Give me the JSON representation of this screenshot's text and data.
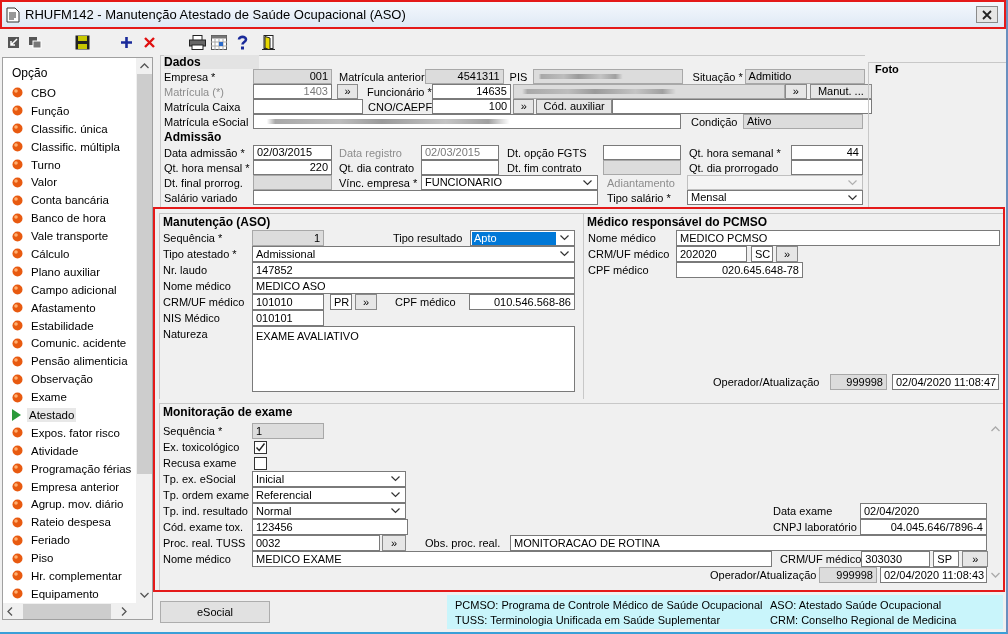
{
  "window": {
    "title": "RHUFM142 - Manutenção Atestado de Saúde Ocupacional (ASO)"
  },
  "sidebar": {
    "heading": "Opção",
    "items": [
      {
        "label": "CBO",
        "selected": false
      },
      {
        "label": "Função",
        "selected": false
      },
      {
        "label": "Classific. única",
        "selected": false
      },
      {
        "label": "Classific. múltipla",
        "selected": false
      },
      {
        "label": "Turno",
        "selected": false
      },
      {
        "label": "Valor",
        "selected": false
      },
      {
        "label": "Conta bancária",
        "selected": false
      },
      {
        "label": "Banco de hora",
        "selected": false
      },
      {
        "label": "Vale transporte",
        "selected": false
      },
      {
        "label": "Cálculo",
        "selected": false
      },
      {
        "label": "Plano auxiliar",
        "selected": false
      },
      {
        "label": "Campo adicional",
        "selected": false
      },
      {
        "label": "Afastamento",
        "selected": false
      },
      {
        "label": "Estabilidade",
        "selected": false
      },
      {
        "label": "Comunic. acidente",
        "selected": false
      },
      {
        "label": "Pensão alimenticia",
        "selected": false
      },
      {
        "label": "Observação",
        "selected": false
      },
      {
        "label": "Exame",
        "selected": false
      },
      {
        "label": "Atestado",
        "selected": true
      },
      {
        "label": "Expos. fator risco",
        "selected": false
      },
      {
        "label": "Atividade",
        "selected": false
      },
      {
        "label": "Programação férias",
        "selected": false
      },
      {
        "label": "Empresa anterior",
        "selected": false
      },
      {
        "label": "Agrup. mov. diário",
        "selected": false
      },
      {
        "label": "Rateio despesa",
        "selected": false
      },
      {
        "label": "Feriado",
        "selected": false
      },
      {
        "label": "Piso",
        "selected": false
      },
      {
        "label": "Hr. complementar",
        "selected": false
      },
      {
        "label": "Equipamento",
        "selected": false
      }
    ]
  },
  "dados": {
    "title": "Dados",
    "items": [
      {
        "kind": "label",
        "text": "Empresa *"
      },
      {
        "kind": "field",
        "value": "001",
        "readonly": true
      },
      {
        "kind": "label",
        "text": "Matrícula anterior"
      },
      {
        "kind": "field",
        "value": "4541311",
        "readonly": true
      },
      {
        "kind": "label",
        "text": "PIS"
      },
      {
        "kind": "field",
        "readonly": true,
        "blurred": true
      },
      {
        "kind": "label",
        "text": "Situação *"
      },
      {
        "kind": "field",
        "value": "Admitido",
        "readonly": true
      },
      {
        "kind": "label",
        "text": "Matrícula (*)",
        "disabled": true
      },
      {
        "kind": "field",
        "value": "1403",
        "disabled": true
      },
      {
        "kind": "button",
        "text": "»"
      },
      {
        "kind": "label",
        "text": "Funcionário *"
      },
      {
        "kind": "field",
        "value": "14635"
      },
      {
        "kind": "field",
        "readonly": true,
        "blurred": true
      },
      {
        "kind": "button",
        "text": "»"
      },
      {
        "kind": "button",
        "text": "Manut. ..."
      },
      {
        "kind": "label",
        "text": "Matrícula Caixa"
      },
      {
        "kind": "field"
      },
      {
        "kind": "label",
        "text": "CNO/CAEPF"
      },
      {
        "kind": "field",
        "value": "100"
      },
      {
        "kind": "button",
        "text": "»"
      },
      {
        "kind": "button",
        "text": "Cód. auxiliar"
      },
      {
        "kind": "field"
      },
      {
        "kind": "label",
        "text": "Matrícula eSocial"
      },
      {
        "kind": "field",
        "blurred": true
      },
      {
        "kind": "label",
        "text": "Condição"
      },
      {
        "kind": "field",
        "value": "Ativo",
        "readonly": true
      }
    ]
  },
  "admissao": {
    "title": "Admissão",
    "items": [
      {
        "kind": "label",
        "text": "Data admissão *"
      },
      {
        "kind": "field",
        "value": "02/03/2015"
      },
      {
        "kind": "label",
        "text": "Data registro",
        "disabled": true
      },
      {
        "kind": "field",
        "value": "02/03/2015",
        "disabled": true
      },
      {
        "kind": "label",
        "text": "Dt. opção FGTS"
      },
      {
        "kind": "field"
      },
      {
        "kind": "label",
        "text": "Qt. hora semanal *"
      },
      {
        "kind": "field",
        "value": "44"
      },
      {
        "kind": "label",
        "text": "Qt. hora mensal *"
      },
      {
        "kind": "field",
        "value": "220"
      },
      {
        "kind": "label",
        "text": "Qt. dia contrato"
      },
      {
        "kind": "field"
      },
      {
        "kind": "label",
        "text": "Dt. fim contrato"
      },
      {
        "kind": "field",
        "readonly": true
      },
      {
        "kind": "label",
        "text": "Qt. dia prorrogado"
      },
      {
        "kind": "field"
      },
      {
        "kind": "label",
        "text": "Dt. final prorrog."
      },
      {
        "kind": "field",
        "readonly": true
      },
      {
        "kind": "label",
        "text": "Vínc. empresa *"
      },
      {
        "kind": "combo",
        "value": "FUNCIONARIO"
      },
      {
        "kind": "label",
        "text": "Adiantamento",
        "disabled": true
      },
      {
        "kind": "combo",
        "disabled": true
      },
      {
        "kind": "label",
        "text": "Salário variado"
      },
      {
        "kind": "field"
      },
      {
        "kind": "label",
        "text": "Tipo salário *"
      },
      {
        "kind": "combo",
        "value": "Mensal"
      }
    ]
  },
  "foto": {
    "title": "Foto"
  },
  "manutencao": {
    "title": "Manutenção (ASO)",
    "items": [
      {
        "kind": "label",
        "text": "Sequência *"
      },
      {
        "kind": "field",
        "value": "1",
        "readonly": true
      },
      {
        "kind": "label",
        "text": "Tipo resultado"
      },
      {
        "kind": "combo",
        "value": "Apto",
        "selected": true
      },
      {
        "kind": "label",
        "text": "Tipo atestado *"
      },
      {
        "kind": "combo",
        "value": "Admissional"
      },
      {
        "kind": "label",
        "text": "Nr. laudo"
      },
      {
        "kind": "field",
        "value": "147852"
      },
      {
        "kind": "label",
        "text": "Nome médico"
      },
      {
        "kind": "field",
        "value": "MEDICO ASO"
      },
      {
        "kind": "label",
        "text": "CRM/UF médico"
      },
      {
        "kind": "field",
        "value": "101010"
      },
      {
        "kind": "field",
        "value": "PR"
      },
      {
        "kind": "button",
        "text": "»"
      },
      {
        "kind": "label",
        "text": "CPF médico"
      },
      {
        "kind": "field",
        "value": "010.546.568-86"
      },
      {
        "kind": "label",
        "text": "NIS Médico"
      },
      {
        "kind": "field",
        "value": "010101"
      },
      {
        "kind": "label",
        "text": "Natureza"
      },
      {
        "kind": "textarea",
        "value": "EXAME AVALIATIVO"
      }
    ],
    "operador": [
      {
        "kind": "label",
        "text": "Operador/Atualização"
      },
      {
        "kind": "field",
        "value": "999998",
        "readonly": true
      },
      {
        "kind": "field",
        "value": "02/04/2020 11:08:47"
      }
    ]
  },
  "medico_pcmso": {
    "title": "Médico responsável do PCMSO",
    "items": [
      {
        "kind": "label",
        "text": "Nome médico"
      },
      {
        "kind": "field",
        "value": "MEDICO PCMSO"
      },
      {
        "kind": "label",
        "text": "CRM/UF médico"
      },
      {
        "kind": "field",
        "value": "202020"
      },
      {
        "kind": "field",
        "value": "SC"
      },
      {
        "kind": "button",
        "text": "»"
      },
      {
        "kind": "label",
        "text": "CPF médico"
      },
      {
        "kind": "field",
        "value": "020.645.648-78"
      }
    ]
  },
  "monitoracao": {
    "title": "Monitoração de exame",
    "items": [
      {
        "kind": "label",
        "text": "Sequência *"
      },
      {
        "kind": "field",
        "value": "1",
        "readonly": true
      },
      {
        "kind": "label",
        "text": "Ex. toxicológico"
      },
      {
        "kind": "checkbox",
        "checked": true
      },
      {
        "kind": "label",
        "text": "Recusa exame"
      },
      {
        "kind": "checkbox",
        "checked": false
      },
      {
        "kind": "label",
        "text": "Tp. ex. eSocial"
      },
      {
        "kind": "combo",
        "value": "Inicial"
      },
      {
        "kind": "label",
        "text": "Tp. ordem exame"
      },
      {
        "kind": "combo",
        "value": "Referencial"
      },
      {
        "kind": "label",
        "text": "Tp. ind. resultado"
      },
      {
        "kind": "combo",
        "value": "Normal"
      },
      {
        "kind": "label",
        "text": "Data exame"
      },
      {
        "kind": "field",
        "value": "02/04/2020"
      },
      {
        "kind": "label",
        "text": "Cód. exame tox."
      },
      {
        "kind": "field",
        "value": "123456"
      },
      {
        "kind": "label",
        "text": "CNPJ laboratório"
      },
      {
        "kind": "field",
        "value": "04.045.646/7896-4"
      },
      {
        "kind": "label",
        "text": "Proc. real. TUSS"
      },
      {
        "kind": "field",
        "value": "0032"
      },
      {
        "kind": "button",
        "text": "»"
      },
      {
        "kind": "label",
        "text": "Obs. proc. real."
      },
      {
        "kind": "field",
        "value": "MONITORACAO DE ROTINA"
      },
      {
        "kind": "label",
        "text": "Nome médico"
      },
      {
        "kind": "field",
        "value": "MEDICO EXAME"
      },
      {
        "kind": "label",
        "text": "CRM/UF médico"
      },
      {
        "kind": "field",
        "value": "303030"
      },
      {
        "kind": "field",
        "value": "SP"
      },
      {
        "kind": "button",
        "text": "»"
      },
      {
        "kind": "label",
        "text": "Operador/Atualização"
      },
      {
        "kind": "field",
        "value": "999998",
        "readonly": true
      },
      {
        "kind": "field",
        "value": "02/04/2020 11:08:43"
      }
    ]
  },
  "footer": {
    "button": "eSocial",
    "legend": [
      "PCMSO: Programa de Controle Médico de Saúde Ocupacional",
      "ASO: Atestado Saúde Ocupacional",
      "TUSS: Terminologia Unificada em Saúde Suplementar",
      "CRM: Conselho Regional de Medicina"
    ]
  }
}
